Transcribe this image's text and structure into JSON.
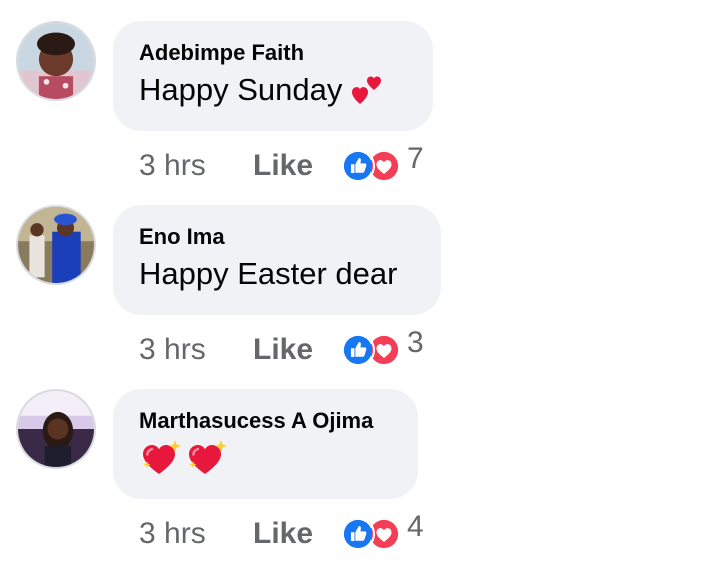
{
  "comments": [
    {
      "author": "Adebimpe Faith",
      "text": "Happy Sunday",
      "emoji_icons": [
        "two-hearts-icon"
      ],
      "time": "3 hrs",
      "like_label": "Like",
      "reaction_icons": [
        "like-reaction-icon",
        "love-reaction-icon"
      ],
      "reaction_count": "7"
    },
    {
      "author": "Eno Ima",
      "text": "Happy Easter dear",
      "emoji_icons": [],
      "time": "3 hrs",
      "like_label": "Like",
      "reaction_icons": [
        "like-reaction-icon",
        "love-reaction-icon"
      ],
      "reaction_count": "3"
    },
    {
      "author": "Marthasucess A Ojima",
      "text": "",
      "emoji_icons": [
        "sparkling-heart-icon",
        "sparkling-heart-icon"
      ],
      "time": "3 hrs",
      "like_label": "Like",
      "reaction_icons": [
        "like-reaction-icon",
        "love-reaction-icon"
      ],
      "reaction_count": "4"
    }
  ],
  "colors": {
    "bubble": "#f0f2f5",
    "meta_text": "#65676b",
    "like_blue": "#1877f2",
    "love_red": "#f33e58"
  }
}
